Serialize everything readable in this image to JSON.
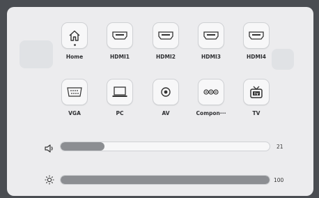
{
  "sources": [
    {
      "label": "Home",
      "icon": "home-icon"
    },
    {
      "label": "HDMI1",
      "icon": "hdmi-icon"
    },
    {
      "label": "HDMI2",
      "icon": "hdmi-icon"
    },
    {
      "label": "HDMI3",
      "icon": "hdmi-icon"
    },
    {
      "label": "HDMI4",
      "icon": "hdmi-icon"
    },
    {
      "label": "VGA",
      "icon": "vga-icon"
    },
    {
      "label": "PC",
      "icon": "laptop-icon"
    },
    {
      "label": "AV",
      "icon": "av-icon"
    },
    {
      "label": "Compon···",
      "icon": "component-icon"
    },
    {
      "label": "TV",
      "icon": "tv-icon"
    }
  ],
  "volume": {
    "icon": "speaker-icon",
    "value": "21",
    "fraction": 0.21
  },
  "brightness": {
    "icon": "sun-icon",
    "value": "100",
    "fraction": 1.0
  },
  "colors": {
    "accent": "#8c8e92",
    "panel": "#ececee",
    "tile": "#f7f7f8"
  }
}
